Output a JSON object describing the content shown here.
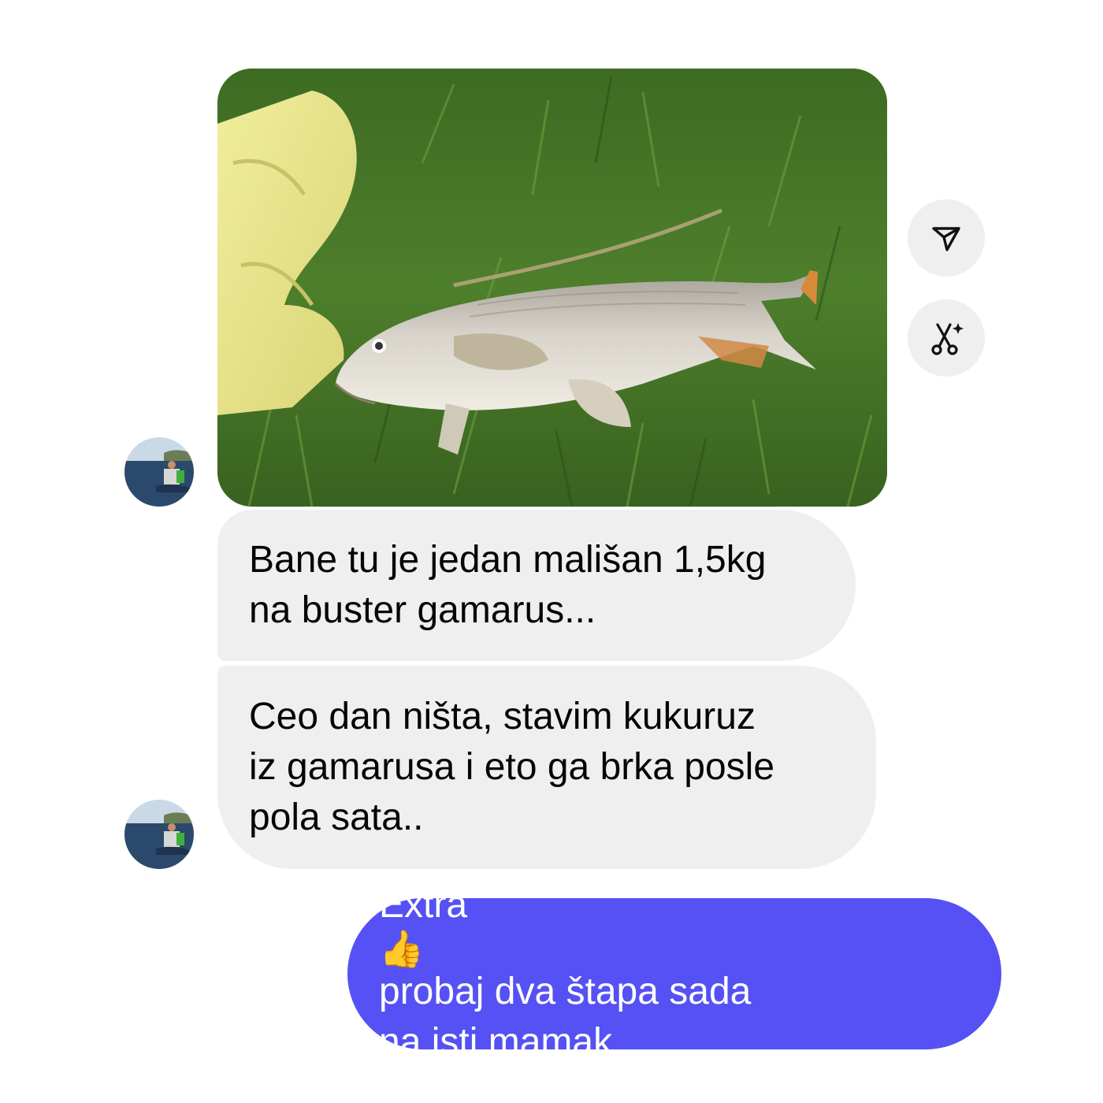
{
  "conversation": {
    "photo_message": {
      "description_icon": "photo-icon"
    },
    "side_actions": [
      {
        "icon": "forward-icon"
      },
      {
        "icon": "ai-tools-icon"
      }
    ],
    "messages": [
      {
        "direction": "received",
        "lines": [
          "Bane tu je jedan mališan 1,5kg",
          "na buster gamarus..."
        ]
      },
      {
        "direction": "received",
        "lines": [
          "Ceo dan ništa, stavim kukuruz",
          "iz gamarusa i eto ga brka posle",
          "pola sata.."
        ]
      },
      {
        "direction": "sent",
        "line1_before_emoji": "Extra ",
        "emoji": "👍",
        "line1_after_emoji": " probaj dva štapa sada",
        "line2": "na isti mamak"
      }
    ]
  },
  "colors": {
    "received_bubble": "#efefef",
    "sent_bubble": "#5551f4",
    "text_dark": "#050505",
    "text_light": "#ffffff"
  }
}
